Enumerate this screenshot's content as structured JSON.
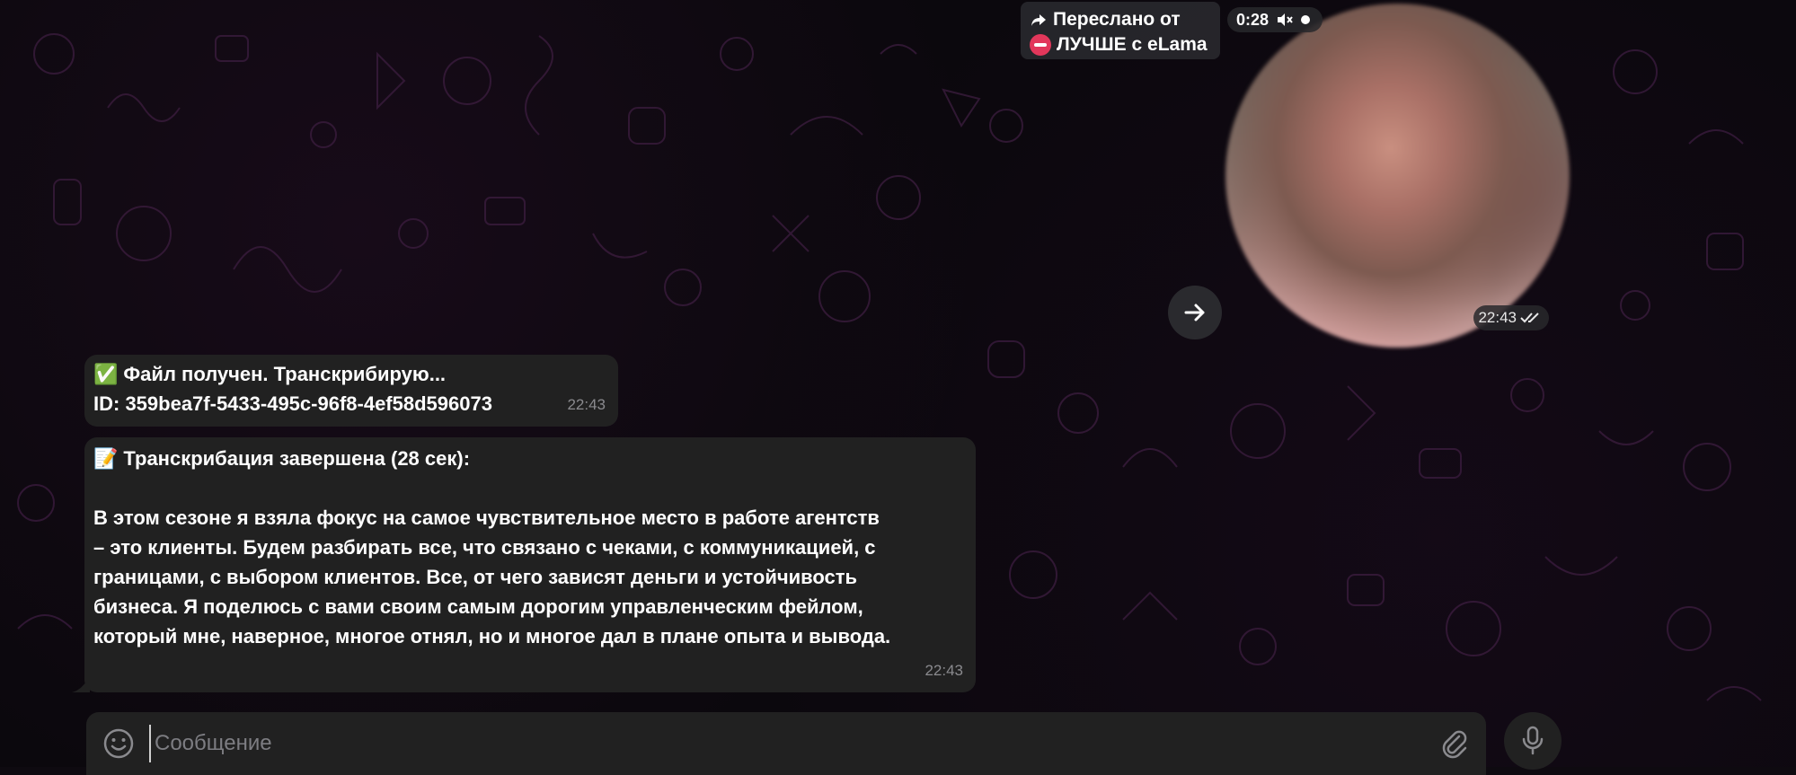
{
  "forwarded": {
    "label": "Переслано от",
    "channel_name": "ЛУЧШЕ с eLama"
  },
  "video_message": {
    "duration": "0:28",
    "time": "22:43"
  },
  "messages": [
    {
      "emoji": "✅",
      "line1": "Файл получен. Транскрибирую...",
      "line2": "ID: 359bea7f-5433-495c-96f8-4ef58d596073",
      "time": "22:43"
    },
    {
      "emoji": "📝",
      "heading": "Транскрибация завершена (28 сек):",
      "lines": [
        "В этом сезоне я взяла фокус на самое чувствительное место в работе агентств",
        "– это клиенты. Будем разбирать все, что связано с чеками, с коммуникацией, с",
        "границами, с выбором клиентов. Все, от чего зависят деньги и устойчивость",
        "бизнеса. Я поделюсь с вами своим самым дорогим управленческим фейлом,",
        "который мне, наверное, многое отнял, но и многое дал в плане опыта и вывода."
      ],
      "time": "22:43"
    }
  ],
  "composer": {
    "placeholder": "Сообщение",
    "value": ""
  },
  "icons": {
    "forward": "forward-arrow-icon",
    "mute": "speaker-muted-icon",
    "share": "share-arrow-icon",
    "read_receipt": "double-check-icon",
    "emoji": "smiley-icon",
    "attach": "paperclip-icon",
    "mic": "microphone-icon"
  },
  "colors": {
    "bubble": "#212121",
    "background": "#0b080d",
    "channel_avatar": "#e2375b",
    "muted_text": "#8a8a8e"
  }
}
